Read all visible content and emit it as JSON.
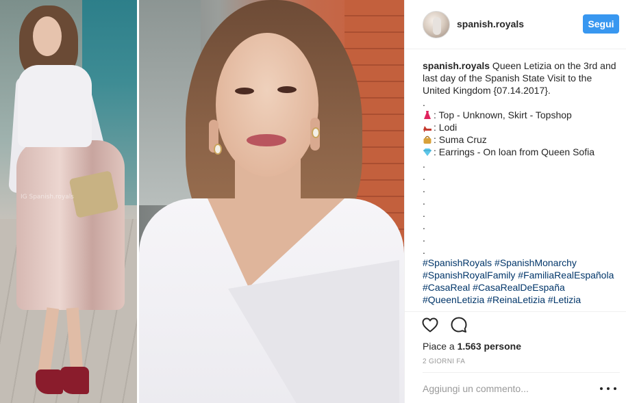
{
  "post": {
    "username": "spanish.royals",
    "follow_label": "Segui",
    "watermark": "IG Spanish.royals",
    "caption": {
      "user": "spanish.royals",
      "text": " Queen Letizia on the 3rd and last day of the Spanish State Visit to the United Kingdom {07.14.2017}."
    },
    "details": [
      {
        "icon": "dress-icon",
        "text": ": Top - Unknown, Skirt - Topshop"
      },
      {
        "icon": "heel-shoe-icon",
        "text": ": Lodi"
      },
      {
        "icon": "handbag-icon",
        "text": ": Suma Cruz"
      },
      {
        "icon": "gem-icon",
        "text": ": Earrings - On loan from Queen Sofia"
      }
    ],
    "hashtags": [
      "#SpanishRoyals #SpanishMonarchy",
      "#SpanishRoyalFamily #FamiliaRealEspañola",
      "#CasaReal #CasaRealDeEspaña",
      "#QueenLetizia #ReinaLetizia #Letizia"
    ],
    "likes_prefix": "Piace a ",
    "likes_count": "1.563 persone",
    "timestamp": "2 GIORNI FA",
    "comment_placeholder": "Aggiungi un commento...",
    "accent_color": "#3897f0"
  }
}
